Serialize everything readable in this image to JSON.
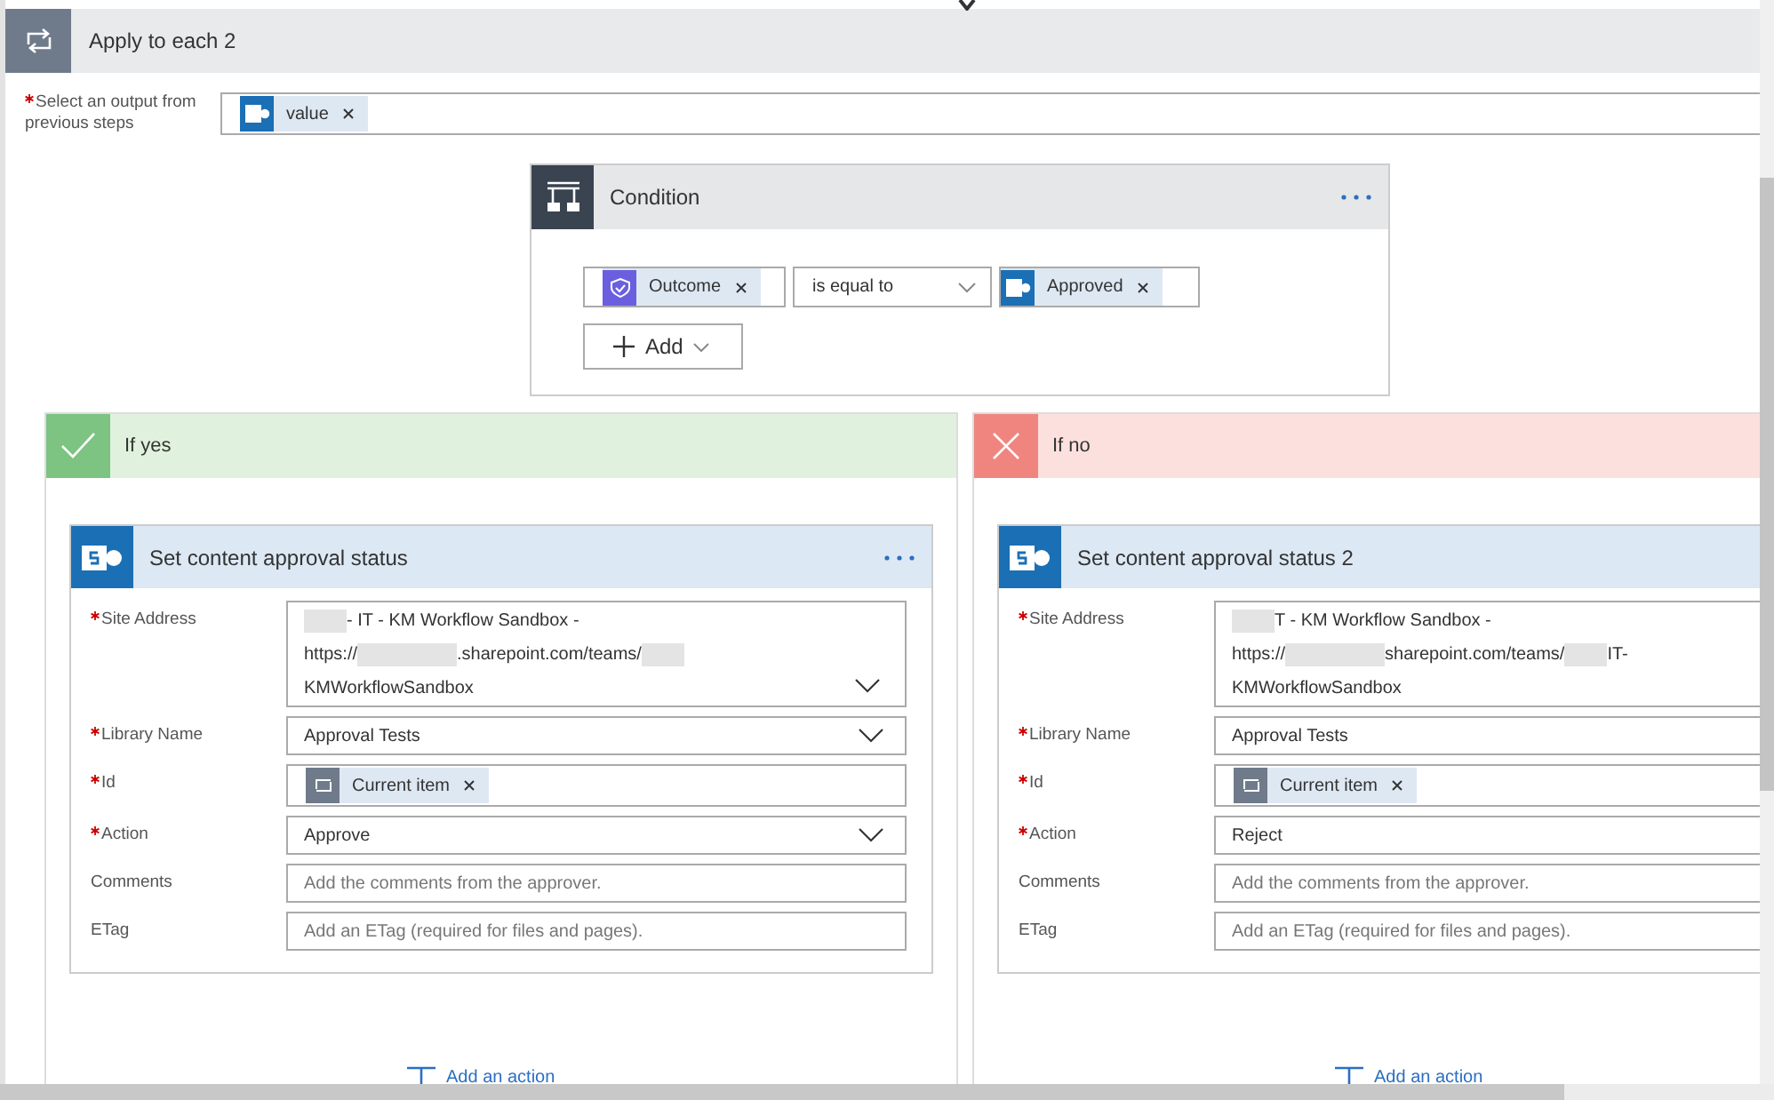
{
  "loop": {
    "title": "Apply to each 2",
    "output_label": "Select an output from previous steps",
    "required": true,
    "token": {
      "label": "value",
      "kind": "sharepoint"
    }
  },
  "condition": {
    "title": "Condition",
    "menu": true,
    "left_token": {
      "label": "Outcome",
      "kind": "approvals"
    },
    "operator": "is equal to",
    "right_token": {
      "label": "Approved",
      "kind": "sharepoint"
    },
    "add_button": "Add"
  },
  "branches": [
    {
      "kind": "yes",
      "title": "If yes",
      "add_action": "Add an action",
      "action": {
        "title": "Set content approval status",
        "menu": true,
        "fields": [
          {
            "label": "Site Address",
            "required": true,
            "kind": "multiline",
            "chevron": true,
            "lines": [
              [
                {
                  "kind": "redacted"
                },
                {
                  "kind": "text",
                  "text": "- IT - KM Workflow Sandbox -"
                }
              ],
              [
                {
                  "kind": "text",
                  "text": "https://"
                },
                {
                  "kind": "redacted"
                },
                {
                  "kind": "text",
                  "text": ".sharepoint.com/teams/"
                },
                {
                  "kind": "redacted"
                }
              ],
              [
                {
                  "kind": "text",
                  "text": "KMWorkflowSandbox"
                }
              ]
            ]
          },
          {
            "label": "Library Name",
            "required": true,
            "kind": "select",
            "chevron": true,
            "value": "Approval Tests"
          },
          {
            "label": "Id",
            "required": true,
            "kind": "token",
            "token": {
              "label": "Current item",
              "kind": "loop"
            }
          },
          {
            "label": "Action",
            "required": true,
            "kind": "select",
            "chevron": true,
            "value": "Approve"
          },
          {
            "label": "Comments",
            "required": false,
            "kind": "text",
            "placeholder": "Add the comments from the approver."
          },
          {
            "label": "ETag",
            "required": false,
            "kind": "text",
            "placeholder": "Add an ETag (required for files and pages)."
          }
        ]
      }
    },
    {
      "kind": "no",
      "title": "If no",
      "add_action": "Add an action",
      "action": {
        "title": "Set content approval status 2",
        "menu": false,
        "fields": [
          {
            "label": "Site Address",
            "required": true,
            "kind": "multiline",
            "chevron": false,
            "lines": [
              [
                {
                  "kind": "redacted"
                },
                {
                  "kind": "text",
                  "text": "T - KM Workflow Sandbox -"
                }
              ],
              [
                {
                  "kind": "text",
                  "text": "https://"
                },
                {
                  "kind": "redacted"
                },
                {
                  "kind": "text",
                  "text": "sharepoint.com/teams/"
                },
                {
                  "kind": "redacted"
                },
                {
                  "kind": "text",
                  "text": "IT-"
                }
              ],
              [
                {
                  "kind": "text",
                  "text": "KMWorkflowSandbox"
                }
              ]
            ]
          },
          {
            "label": "Library Name",
            "required": true,
            "kind": "select",
            "chevron": false,
            "value": "Approval Tests"
          },
          {
            "label": "Id",
            "required": true,
            "kind": "token",
            "token": {
              "label": "Current item",
              "kind": "loop"
            }
          },
          {
            "label": "Action",
            "required": true,
            "kind": "select",
            "chevron": false,
            "value": "Reject"
          },
          {
            "label": "Comments",
            "required": false,
            "kind": "text",
            "placeholder": "Add the comments from the approver."
          },
          {
            "label": "ETag",
            "required": false,
            "kind": "text",
            "placeholder": "Add an ETag (required for files and pages)."
          }
        ]
      }
    }
  ]
}
